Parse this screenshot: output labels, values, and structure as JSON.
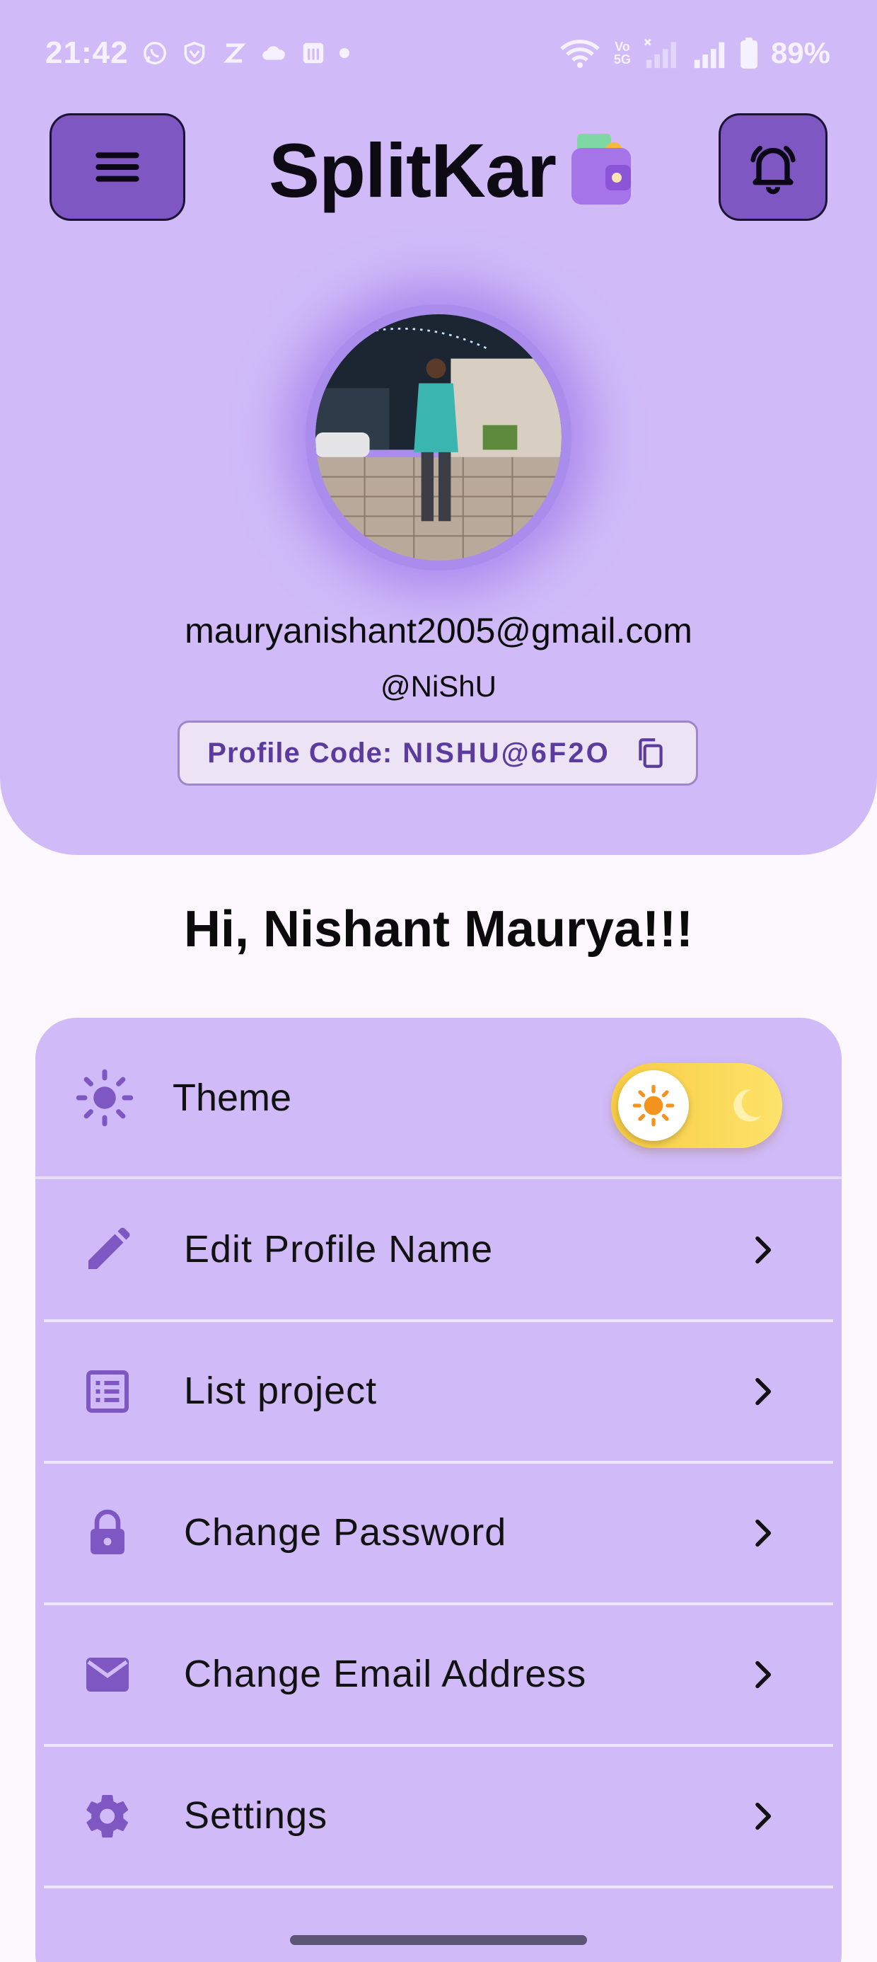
{
  "status_bar": {
    "time": "21:42",
    "volte_line1": "Vo",
    "volte_line2": "5G",
    "battery": "89%"
  },
  "app_bar": {
    "title": "SplitKar",
    "menu_icon": "hamburger-menu-icon",
    "bell_icon": "notification-bell-icon"
  },
  "profile": {
    "email": "mauryanishant2005@gmail.com",
    "handle": "@NiShU",
    "code_label": "Profile Code:",
    "code_value": "NISHU@6F2O"
  },
  "greeting": "Hi, Nishant Maurya!!!",
  "theme": {
    "label": "Theme",
    "mode": "light"
  },
  "menu_items": [
    {
      "label": "Edit Profile Name",
      "icon": "pencil-icon"
    },
    {
      "label": "List project",
      "icon": "list-icon"
    },
    {
      "label": "Change Password",
      "icon": "lock-icon"
    },
    {
      "label": "Change Email Address",
      "icon": "mail-icon"
    },
    {
      "label": "Settings",
      "icon": "gear-icon"
    }
  ],
  "colors": {
    "primary": "#7e57c2",
    "panel": "#d0bbf8",
    "background": "#fdf7fe",
    "accent_text": "#5b3c9e",
    "toggle": "#f7cc44"
  }
}
